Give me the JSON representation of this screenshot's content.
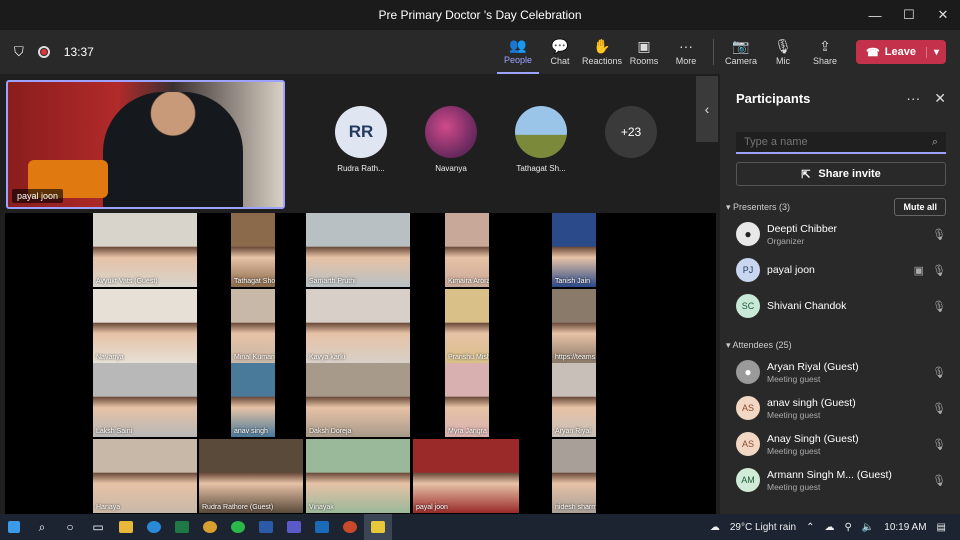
{
  "window": {
    "title": "Pre Primary Doctor 's Day Celebration",
    "controls": [
      "—",
      "☐",
      "✕"
    ]
  },
  "toolbar": {
    "timer": "13:37",
    "buttons": [
      {
        "label": "People",
        "icon": "people-icon",
        "glyph": "👥",
        "active": true
      },
      {
        "label": "Chat",
        "icon": "chat-icon",
        "glyph": "💬"
      },
      {
        "label": "Reactions",
        "icon": "reactions-icon",
        "glyph": "✋"
      },
      {
        "label": "Rooms",
        "icon": "rooms-icon",
        "glyph": "▣"
      },
      {
        "label": "More",
        "icon": "more-icon",
        "glyph": "···"
      }
    ],
    "av_buttons": [
      {
        "label": "Camera",
        "icon": "camera-off-icon",
        "glyph": "📷"
      },
      {
        "label": "Mic",
        "icon": "mic-off-icon",
        "glyph": "🎙"
      },
      {
        "label": "Share",
        "icon": "share-icon",
        "glyph": "⇪"
      }
    ],
    "leave_label": "Leave"
  },
  "stage": {
    "spotlight_name": "payal joon",
    "top_participants": [
      {
        "initials": "RR",
        "name": "Rudra Rath...",
        "style": "ta-rr"
      },
      {
        "initials": "",
        "name": "Navanya",
        "style": "ta-nav"
      },
      {
        "initials": "",
        "name": "Tathagat Sh...",
        "style": "ta-tat"
      }
    ],
    "more_count": "+23",
    "tiles": [
      {
        "name": "Avyukt Vats (Guest)",
        "bg": "#d8d4cc"
      },
      {
        "name": "Tathagat Shom",
        "bg": "#8a6a4a"
      },
      {
        "name": "Samarth Pruthi",
        "bg": "#b8c0c4"
      },
      {
        "name": "Kimaira Arora",
        "bg": "#c8a898"
      },
      {
        "name": "Tanish Jain",
        "bg": "#2a4a8a"
      },
      {
        "name": "Navanya",
        "bg": "#e6e0d6"
      },
      {
        "name": "Minal Kumari",
        "bg": "#c8b8a8"
      },
      {
        "name": "Kavya karki",
        "bg": "#d8d0c8"
      },
      {
        "name": "Pranshu Mishra",
        "bg": "#d8c088"
      },
      {
        "name": "https://teams.micros...",
        "bg": "#8a7a6a"
      },
      {
        "name": "Laksh  Saini",
        "bg": "#b8b8b8"
      },
      {
        "name": "anav singh",
        "bg": "#4a7a9a"
      },
      {
        "name": "Daksh Doreja",
        "bg": "#a89a8a"
      },
      {
        "name": "Myra  Jangra",
        "bg": "#d8b0b0"
      },
      {
        "name": "Aryan Riyal",
        "bg": "#c8c0b8"
      },
      {
        "name": "Hanaya",
        "bg": "#c8b8a8"
      },
      {
        "name": "Rudra Rathore (Guest)",
        "bg": "#5a4a3a"
      },
      {
        "name": "Vinayak",
        "bg": "#9ab89a"
      },
      {
        "name": "payal joon",
        "bg": "#9a2a2a"
      },
      {
        "name": "nidesh sharma",
        "bg": "#a8a098"
      }
    ]
  },
  "panel": {
    "title": "Participants",
    "search_placeholder": "Type a name",
    "share_invite": "Share invite",
    "presenters_header": "Presenters (3)",
    "mute_all": "Mute all",
    "presenters": [
      {
        "initials": "",
        "name": "Deepti Chibber",
        "sub": "Organizer",
        "color": "#e8e8e8",
        "fg": "#222",
        "icons": [
          "🎙"
        ]
      },
      {
        "initials": "PJ",
        "name": "payal joon",
        "sub": "",
        "color": "#c8d6f0",
        "fg": "#243a5e",
        "icons": [
          "▣",
          "🎙"
        ]
      },
      {
        "initials": "SC",
        "name": "Shivani Chandok",
        "sub": "",
        "color": "#c8e8d8",
        "fg": "#1e5a3a",
        "icons": [
          "🎙"
        ]
      }
    ],
    "attendees_header": "Attendees (25)",
    "attendees": [
      {
        "initials": "",
        "name": "Aryan Riyal (Guest)",
        "sub": "Meeting guest",
        "color": "#9a9a9a",
        "fg": "#fff"
      },
      {
        "initials": "AS",
        "name": "anav singh (Guest)",
        "sub": "Meeting guest",
        "color": "#f2d8c4",
        "fg": "#8a4a2a"
      },
      {
        "initials": "AS",
        "name": "Anay Singh (Guest)",
        "sub": "Meeting guest",
        "color": "#f2d8c4",
        "fg": "#8a4a2a"
      },
      {
        "initials": "AM",
        "name": "Armann Singh M... (Guest)",
        "sub": "Meeting guest",
        "color": "#d0ecd8",
        "fg": "#1e5a3a"
      }
    ]
  },
  "taskbar": {
    "weather": "29°C  Light rain",
    "time": "10:19 AM"
  }
}
